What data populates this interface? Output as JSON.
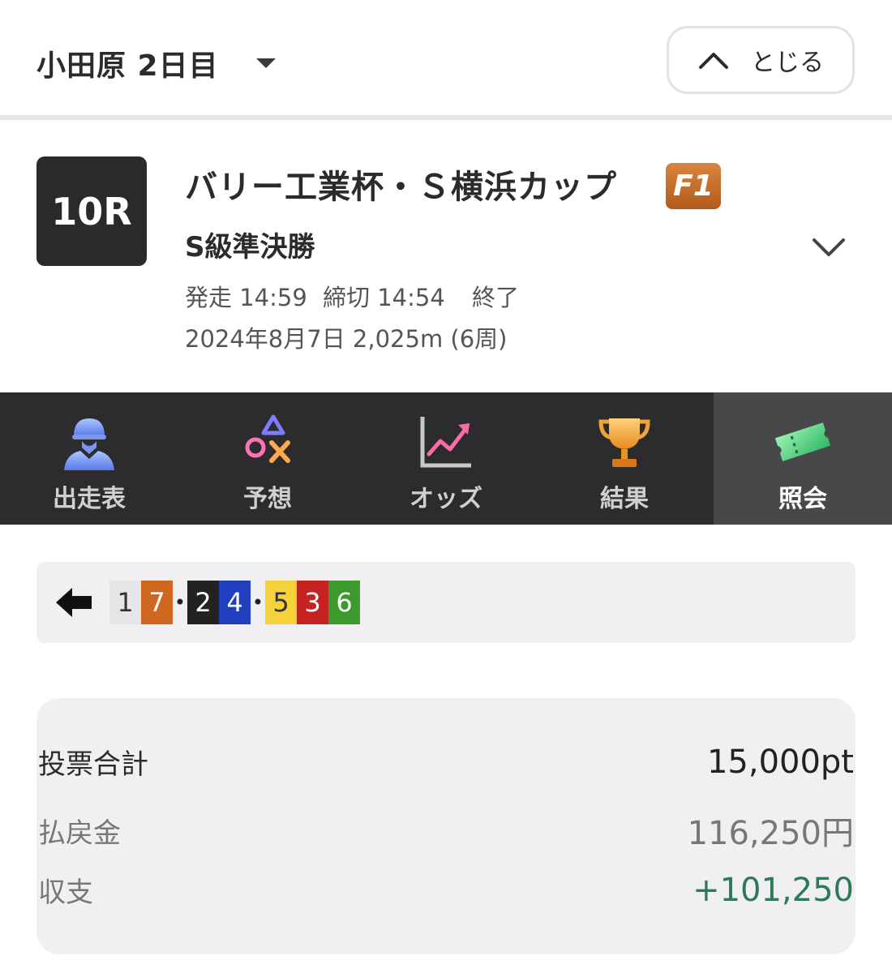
{
  "header": {
    "venue": "小田原 2日目",
    "close_label": "とじる"
  },
  "race": {
    "number": "10R",
    "title": "バリー工業杯・Ｓ横浜カップ",
    "grade": "F1",
    "grade_color": "#c46a28",
    "subtitle": "S級準決勝",
    "start": "発走 14:59",
    "deadline": "締切 14:54",
    "status": "終了",
    "date_distance": "2024年8月7日 2,025m (6周)"
  },
  "tabs": [
    {
      "label": "出走表",
      "icon": "rider-icon"
    },
    {
      "label": "予想",
      "icon": "prediction-marks-icon"
    },
    {
      "label": "オッズ",
      "icon": "odds-chart-icon"
    },
    {
      "label": "結果",
      "icon": "trophy-icon"
    },
    {
      "label": "照会",
      "icon": "ticket-icon",
      "active": true
    }
  ],
  "combo": {
    "numbers": [
      {
        "n": "1",
        "bg": "#e6e6e8",
        "fg": "#333333"
      },
      {
        "n": "7",
        "bg": "#d0671f",
        "fg": "#ffffff"
      },
      {
        "n": "2",
        "bg": "#222222",
        "fg": "#ffffff"
      },
      {
        "n": "4",
        "bg": "#1f3fbf",
        "fg": "#ffffff"
      },
      {
        "n": "5",
        "bg": "#f5d23a",
        "fg": "#333333"
      },
      {
        "n": "3",
        "bg": "#c62222",
        "fg": "#ffffff"
      },
      {
        "n": "6",
        "bg": "#3d9a2f",
        "fg": "#ffffff"
      }
    ],
    "separator": "•"
  },
  "summary": {
    "total_label": "投票合計",
    "total_value": "15,000pt",
    "payout_label": "払戻金",
    "payout_value": "116,250円",
    "balance_label": "収支",
    "balance_value": "+101,250",
    "balance_color": "#2f7a56"
  }
}
